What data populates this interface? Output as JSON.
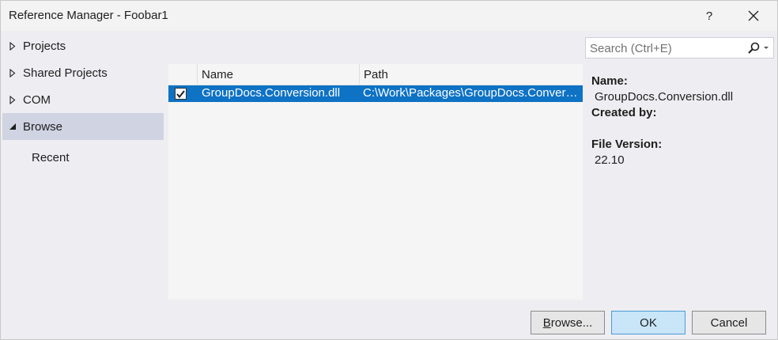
{
  "window": {
    "title": "Reference Manager - Foobar1",
    "help_label": "?"
  },
  "nav": {
    "items": [
      {
        "label": "Projects",
        "expanded": false
      },
      {
        "label": "Shared Projects",
        "expanded": false
      },
      {
        "label": "COM",
        "expanded": false
      },
      {
        "label": "Browse",
        "expanded": true,
        "selected": true
      }
    ],
    "sub_items": [
      {
        "label": "Recent"
      }
    ]
  },
  "search": {
    "placeholder": "Search (Ctrl+E)",
    "value": ""
  },
  "list": {
    "columns": [
      "Name",
      "Path"
    ],
    "rows": [
      {
        "checked": true,
        "name": "GroupDocs.Conversion.dll",
        "path": "C:\\Work\\Packages\\GroupDocs.Conversi..."
      }
    ]
  },
  "details": {
    "name_label": "Name:",
    "name_value": "GroupDocs.Conversion.dll",
    "created_label": "Created by:",
    "version_label": "File Version:",
    "version_value": "22.10"
  },
  "buttons": {
    "browse_prefix": "",
    "browse_underline": "B",
    "browse_rest": "rowse...",
    "ok": "OK",
    "cancel": "Cancel"
  },
  "colors": {
    "accent": "#0e72c5",
    "nav_selected": "#cfd3e2",
    "ok_button": "#c9e5f8"
  }
}
